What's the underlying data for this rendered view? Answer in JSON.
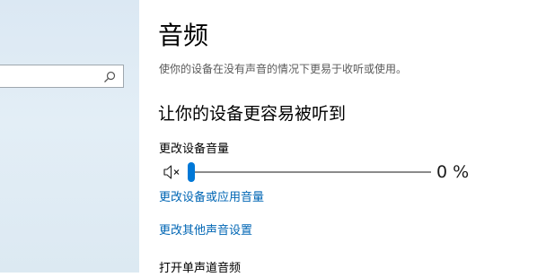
{
  "page": {
    "title": "音频",
    "description": "使你的设备在没有声音的情况下更易于收听或使用。"
  },
  "section": {
    "heading": "让你的设备更容易被听到",
    "volume_label": "更改设备音量",
    "volume": {
      "value_text": "0 %",
      "level_percent": 0,
      "accent_color": "#0078d7"
    },
    "links": {
      "app_volume": "更改设备或应用音量",
      "other_sound_settings": "更改其他声音设置"
    },
    "mono_audio_label": "打开单声道音频"
  },
  "icons": {
    "search": "search-icon",
    "mute": "speaker-muted-icon"
  },
  "colors": {
    "link": "#0066b4",
    "sidebar_background": "#dbe8f3"
  }
}
